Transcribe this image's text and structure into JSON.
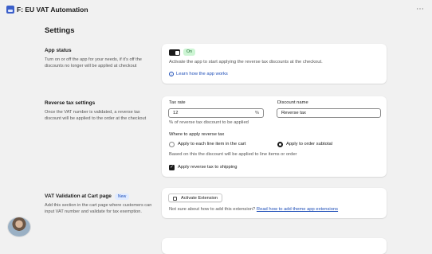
{
  "app": {
    "title": "F: EU VAT Automation",
    "more_label": "⋯"
  },
  "page": {
    "title": "Settings"
  },
  "app_status": {
    "title": "App status",
    "description": "Turn on or off the app for your needs, if it's off the discounts no longer will be applied at checkout",
    "toggle_state": "on",
    "badge": "On",
    "info_text": "Activate the app to start applying the reverse tax discounts at the checkout.",
    "learn_link": "Learn how the app works"
  },
  "reverse_tax": {
    "title": "Reverse tax settings",
    "description": "Once the VAT number is validated, a reverse tax discount will be applied to the order at the checkout",
    "tax_rate_label": "Tax rate",
    "tax_rate_value": "12",
    "tax_rate_suffix": "%",
    "tax_rate_help": "% of reverse tax discount to be applied",
    "discount_name_label": "Discount name",
    "discount_name_value": "Reverse tax",
    "where_label": "Where to apply reverse tax",
    "option_line_item": "Apply to each line item in the cart",
    "option_subtotal": "Apply to order subtotal",
    "selected_option": "subtotal",
    "based_on_text": "Based on this the discount will be applied to line items or order",
    "shipping_label": "Apply reverse tax to shipping",
    "shipping_checked": true
  },
  "vat_validation": {
    "title": "VAT Validation at Cart page",
    "badge": "New",
    "description": "Add this section in the cart page where customers can input VAT number and validate for tax exemption.",
    "activate_button": "Activate Extension",
    "help_text": "Not sure about how to add this extension?",
    "help_link": "Read how to add theme app extensions"
  },
  "colors": {
    "background": "#f1f1f1",
    "card": "#ffffff",
    "link": "#1f4fb8",
    "on_badge_bg": "#cdf5d4",
    "new_badge_bg": "#e0ebff"
  }
}
